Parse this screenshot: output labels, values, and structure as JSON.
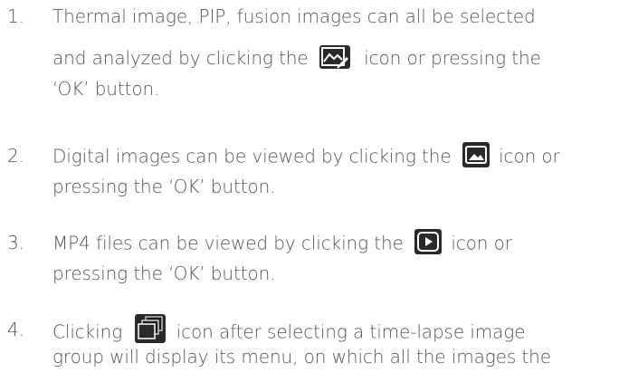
{
  "items": [
    {
      "number": "1.",
      "line1": "Thermal image, PIP, fusion images can all be selected",
      "line2_before": "and analyzed by clicking the",
      "line2_after": "icon or pressing the",
      "line3": "‘OK’ button.",
      "icon": "image-analysis-icon"
    },
    {
      "number": "2.",
      "line1_before": "Digital images can be viewed by clicking the",
      "line1_after": "icon or",
      "line2": "pressing the ‘OK’ button.",
      "icon": "image-view-icon"
    },
    {
      "number": "3.",
      "line1_before": "MP4 files can be viewed by clicking the",
      "line1_after": "icon or",
      "line2": "pressing the ‘OK’ button.",
      "icon": "play-icon"
    },
    {
      "number": "4.",
      "line1_before": "Clicking",
      "line1_after": "icon after selecting a time-lapse image",
      "line2": "group will display its menu, on which all the images the",
      "icon": "image-group-icon"
    }
  ]
}
